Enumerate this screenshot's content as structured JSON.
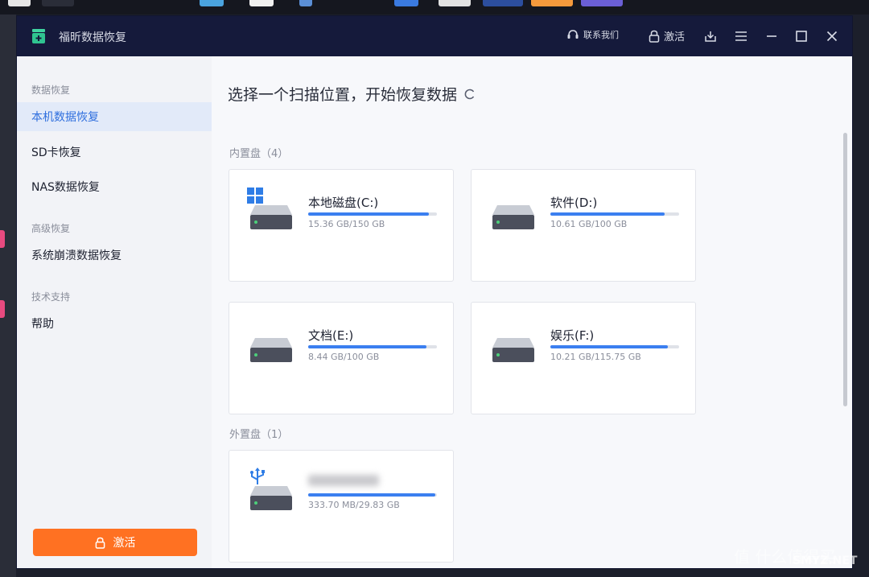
{
  "app": {
    "title": "福昕数据恢复",
    "contact_label": "联系我们",
    "activate_label": "激活"
  },
  "sidebar": {
    "groups": [
      {
        "label": "数据恢复",
        "items": [
          "本机数据恢复",
          "SD卡恢复",
          "NAS数据恢复"
        ]
      },
      {
        "label": "高级恢复",
        "items": [
          "系统崩溃数据恢复"
        ]
      },
      {
        "label": "技术支持",
        "items": [
          "帮助"
        ]
      }
    ],
    "active_item": "本机数据恢复",
    "activate_button": "激活"
  },
  "main": {
    "title": "选择一个扫描位置，开始恢复数据",
    "internal_label": "内置盘（4）",
    "external_label": "外置盘（1）",
    "internal_drives": [
      {
        "name": "本地磁盘(C:)",
        "size": "15.36 GB/150 GB",
        "used_fraction": 0.94,
        "icon": "windows-logo-icon"
      },
      {
        "name": "软件(D:)",
        "size": "10.61 GB/100 GB",
        "used_fraction": 0.89,
        "icon": ""
      },
      {
        "name": "文档(E:)",
        "size": "8.44 GB/100 GB",
        "used_fraction": 0.92,
        "icon": ""
      },
      {
        "name": "娱乐(F:)",
        "size": "10.21 GB/115.75 GB",
        "used_fraction": 0.91,
        "icon": ""
      }
    ],
    "external_drives": [
      {
        "name": "",
        "size": "333.70 MB/29.83 GB",
        "used_fraction": 0.99,
        "icon": "usb-icon"
      }
    ]
  },
  "watermark": {
    "text": "值 什么值得买",
    "sub": "SMYZ.NET"
  },
  "colors": {
    "titlebar": "#151a3b",
    "accent": "#3b7ff0",
    "active_item": "#2f6fde",
    "activate_button": "#ff7122"
  }
}
